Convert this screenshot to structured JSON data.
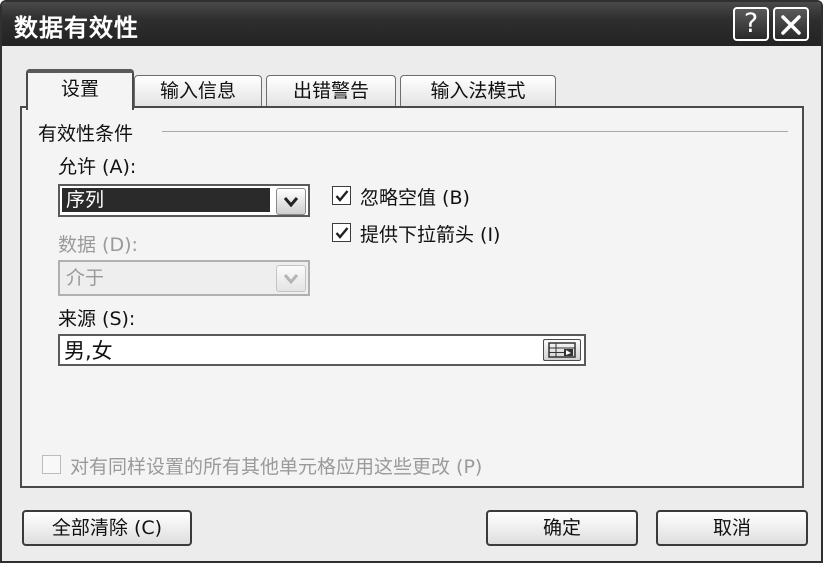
{
  "window": {
    "title": "数据有效性",
    "help_label": "?"
  },
  "tabs": [
    {
      "label": "设置",
      "active": true
    },
    {
      "label": "输入信息",
      "active": false
    },
    {
      "label": "出错警告",
      "active": false
    },
    {
      "label": "输入法模式",
      "active": false
    }
  ],
  "settings": {
    "group_title": "有效性条件",
    "allow": {
      "label": "允许 (A):",
      "value": "序列"
    },
    "ignore_blank": {
      "label": "忽略空值 (B)",
      "checked": true
    },
    "dropdown_arrow": {
      "label": "提供下拉箭头 (I)",
      "checked": true
    },
    "data": {
      "label": "数据 (D):",
      "value": "介于",
      "enabled": false
    },
    "source": {
      "label": "来源 (S):",
      "value": "男,女"
    },
    "apply_all": {
      "label": "对有同样设置的所有其他单元格应用这些更改 (P)",
      "checked": false,
      "enabled": false
    }
  },
  "buttons": {
    "clear_all": "全部清除 (C)",
    "ok": "确定",
    "cancel": "取消"
  }
}
